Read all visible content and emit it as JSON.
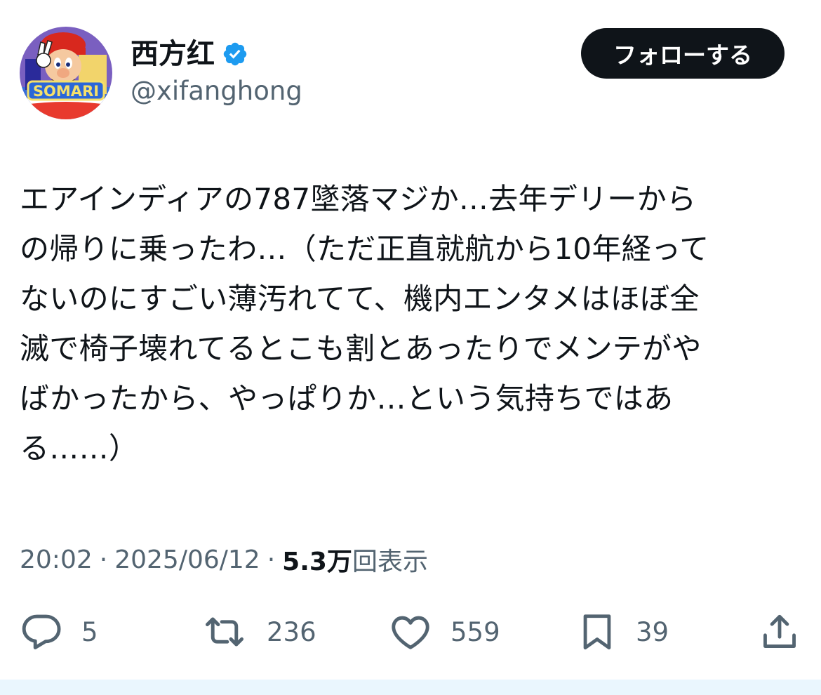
{
  "author": {
    "display_name": "西方红",
    "handle": "@xifanghong",
    "verified": true,
    "avatar_text": "SOMARI"
  },
  "follow_button": {
    "label": "フォローする"
  },
  "tweet": {
    "text": "エアインディアの787墜落マジか…去年デリーから\nの帰りに乗ったわ…（ただ正直就航から10年経って\nないのにすごい薄汚れてて、機内エンタメはほぼ全\n滅で椅子壊れてるとこも割とあったりでメンテがや\nばかったから、やっぱりか…という気持ちではあ\nる……）"
  },
  "meta": {
    "time": "20:02",
    "date": "2025/06/12",
    "separator": "·",
    "views_count": "5.3万",
    "views_label": "回表示"
  },
  "actions": {
    "replies": "5",
    "reposts": "236",
    "likes": "559",
    "bookmarks": "39"
  },
  "icons": {
    "verified": "verified-badge-icon",
    "reply": "reply-icon",
    "repost": "repost-icon",
    "like": "heart-icon",
    "bookmark": "bookmark-icon",
    "share": "share-icon"
  },
  "colors": {
    "text_primary": "#0f1419",
    "text_secondary": "#536471",
    "verified_blue": "#1d9bf0",
    "follow_button_bg": "#0f1419"
  }
}
